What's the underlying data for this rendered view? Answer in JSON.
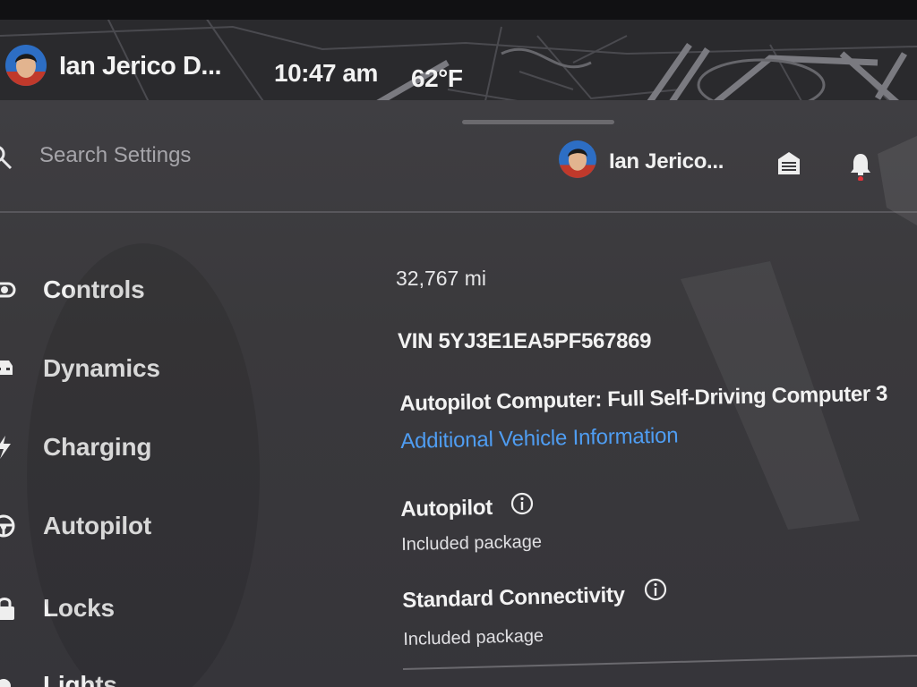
{
  "topbar": {
    "user_name": "Ian Jerico D...",
    "time": "10:47 am",
    "temperature": "62°F"
  },
  "settings_header": {
    "search_placeholder": "Search Settings",
    "profile_name": "Ian Jerico...",
    "icons": [
      "search-icon",
      "garage-icon",
      "bell-icon"
    ],
    "notification_dot_color": "#e0323a"
  },
  "sidebar": {
    "items": [
      {
        "label": "Controls",
        "icon": "toggle-icon"
      },
      {
        "label": "Dynamics",
        "icon": "car-icon"
      },
      {
        "label": "Charging",
        "icon": "bolt-icon"
      },
      {
        "label": "Autopilot",
        "icon": "steering-wheel-icon"
      },
      {
        "label": "Locks",
        "icon": "lock-icon"
      },
      {
        "label": "Lights",
        "icon": "light-icon"
      }
    ]
  },
  "vehicle": {
    "odometer": "32,767  mi",
    "vin": "VIN 5YJ3E1EA5PF567869",
    "autopilot_computer": "Autopilot Computer: Full Self-Driving Computer 3",
    "additional_info_link": "Additional Vehicle Information",
    "packages": [
      {
        "title": "Autopilot",
        "status": "Included package"
      },
      {
        "title": "Standard Connectivity",
        "status": "Included package"
      }
    ]
  },
  "colors": {
    "link": "#4f9df2",
    "panel_bg": "#3b3a3d",
    "map_bg": "#28282b"
  }
}
